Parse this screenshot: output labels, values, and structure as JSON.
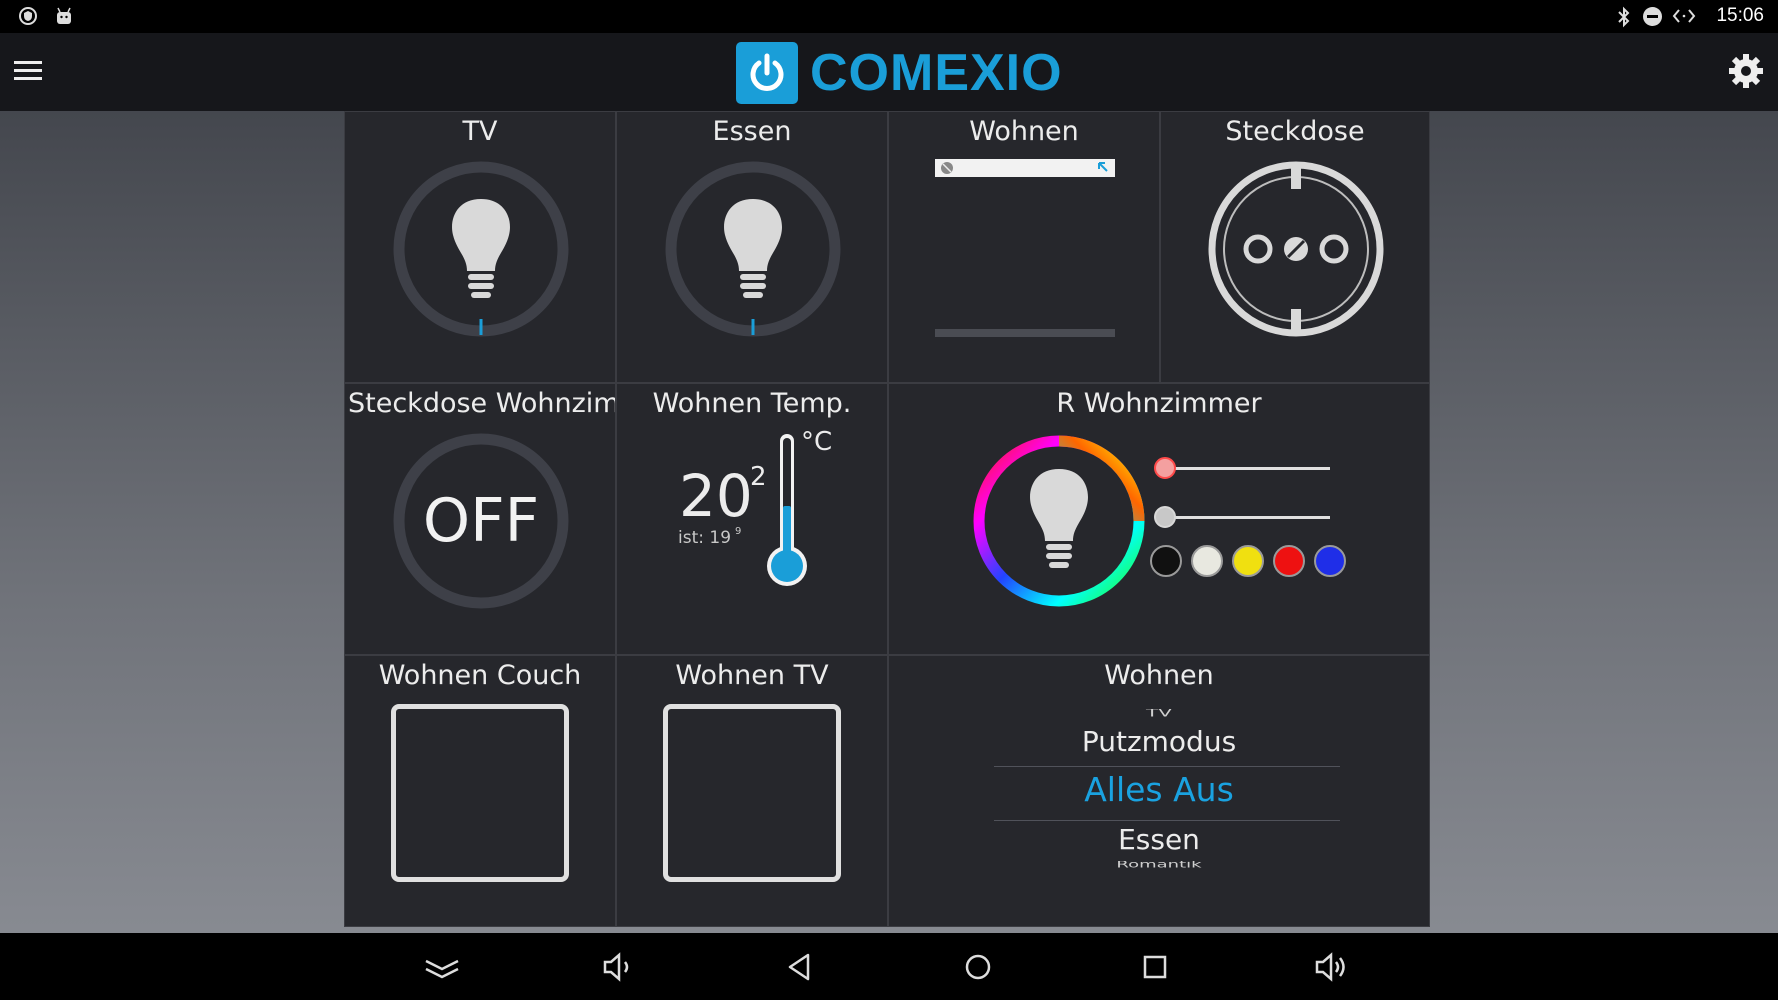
{
  "statusbar": {
    "time": "15:06"
  },
  "app": {
    "logo_text": "COMEXIO"
  },
  "tiles": {
    "tv": {
      "title": "TV"
    },
    "essen": {
      "title": "Essen"
    },
    "wohnen_shutter": {
      "title": "Wohnen"
    },
    "steckdose": {
      "title": "Steckdose"
    },
    "steckdose_wohnzimmer": {
      "title": "Steckdose Wohnzim",
      "state": "OFF"
    },
    "wohnen_temp": {
      "title": "Wohnen Temp.",
      "setpoint": "20",
      "setpoint_decimal": "2",
      "unit": "°C",
      "actual": "ist: 19",
      "actual_decimal": "9",
      "fill_fraction": 0.45
    },
    "r_wohnzimmer": {
      "title": "R Wohnzimmer",
      "slider_1_level": 0.0,
      "slider_2_level": 0.0,
      "preset_colors": [
        "#111111",
        "#e8e8e0",
        "#f0e010",
        "#ee1111",
        "#1f2ee8"
      ]
    },
    "wohnen_couch": {
      "title": "Wohnen Couch"
    },
    "wohnen_tv": {
      "title": "Wohnen TV"
    },
    "wohnen_scenes": {
      "title": "Wohnen",
      "items": [
        "TV",
        "Putzmodus",
        "Alles Aus",
        "Essen",
        "Romantik"
      ],
      "selected": "Alles Aus"
    }
  },
  "icons": {
    "statusbar_left": [
      "shield-icon",
      "android-icon"
    ],
    "statusbar_right": [
      "bluetooth-icon",
      "do-not-disturb-icon",
      "data-sync-icon"
    ],
    "navbar": [
      "collapse-icon",
      "volume-down-icon",
      "back-icon",
      "home-icon",
      "recents-icon",
      "volume-up-icon"
    ]
  },
  "colors": {
    "accent": "#1a9ed8",
    "tile_bg": "#26272c",
    "selected_scene": "#1aa2e0"
  }
}
